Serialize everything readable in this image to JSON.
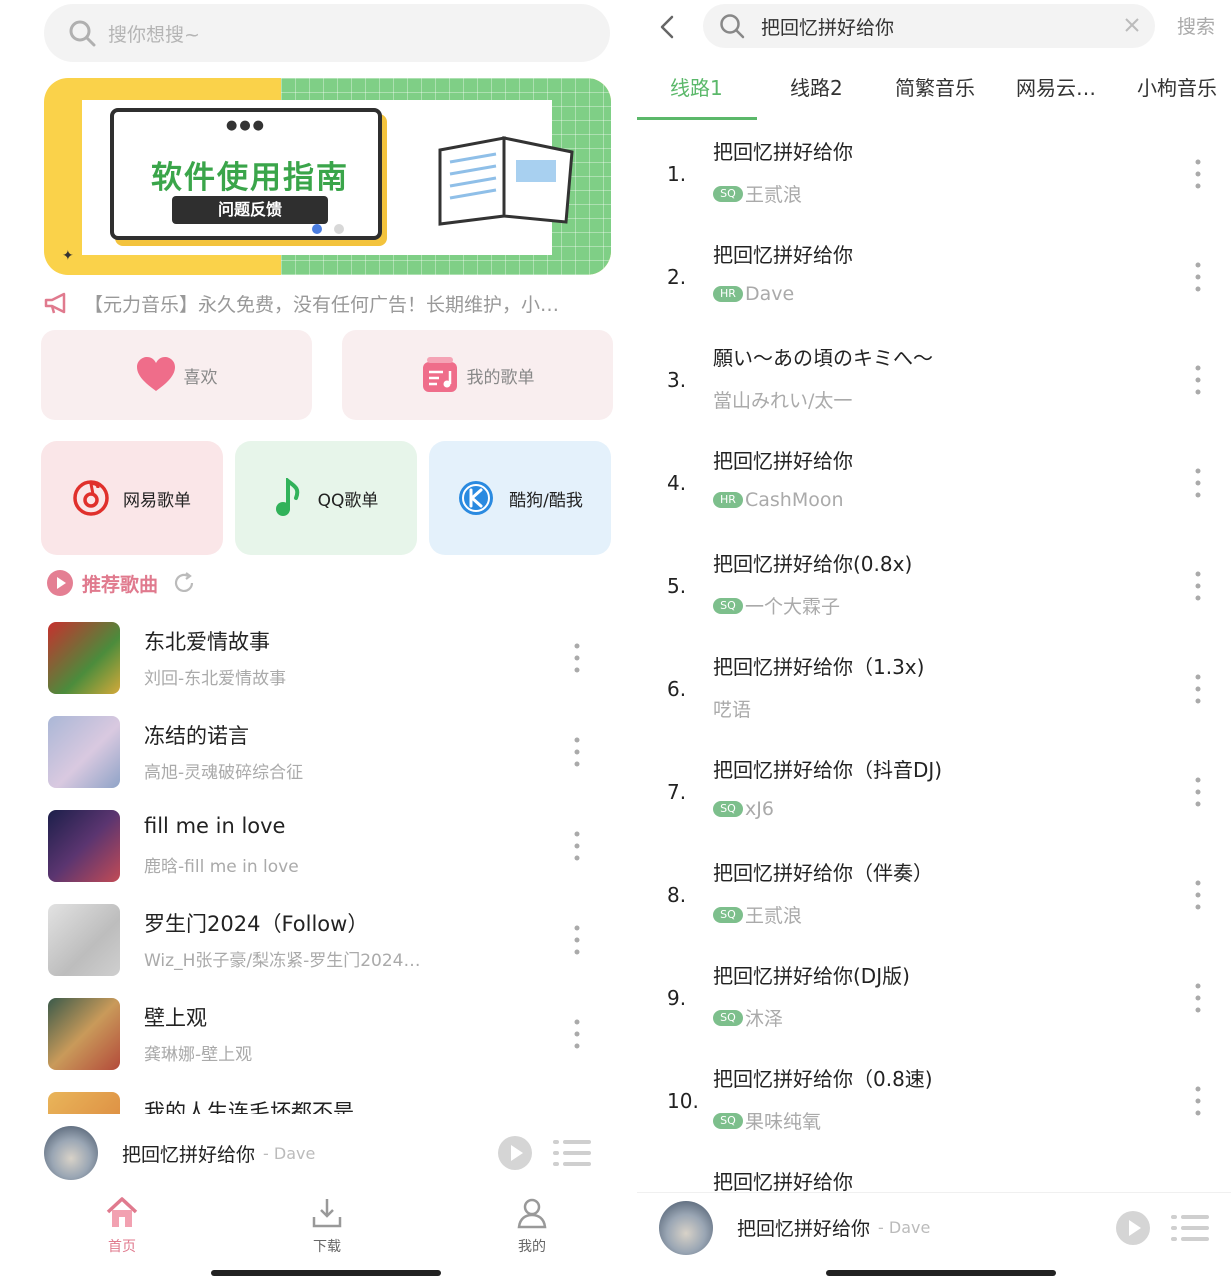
{
  "left": {
    "search": {
      "placeholder": "搜你想搜~"
    },
    "banner": {
      "dots": "●●●",
      "title": "软件使用指南",
      "tag": "问题反馈"
    },
    "notice": "【元力音乐】永久免费，没有任何广告！长期维护，小…",
    "quick": [
      {
        "label": "喜欢",
        "icon": "heart-icon"
      },
      {
        "label": "我的歌单",
        "icon": "playlist-icon"
      }
    ],
    "platforms": [
      {
        "label": "网易歌单",
        "icon": "netease-icon",
        "bg": "#fae6e8"
      },
      {
        "label": "QQ歌单",
        "icon": "qq-music-icon",
        "bg": "#e7f5ea"
      },
      {
        "label": "酷狗/酷我",
        "icon": "kugou-icon",
        "bg": "#e4f1fb"
      }
    ],
    "recommend_title": "推荐歌曲",
    "songs": [
      {
        "title": "东北爱情故事",
        "sub": "刘回-东北爱情故事"
      },
      {
        "title": "冻结的诺言",
        "sub": "高旭-灵魂破碎综合征"
      },
      {
        "title": "fill me in love",
        "sub": "鹿晗-fill me in love"
      },
      {
        "title": "罗生门2024（Follow）",
        "sub": "Wiz_H张子豪/梨冻紧-罗生门2024…"
      },
      {
        "title": "壁上观",
        "sub": "龚琳娜-壁上观"
      },
      {
        "title": "我的人生连毛坏都不是",
        "sub": ""
      }
    ],
    "player": {
      "title": "把回忆拼好给你",
      "artist": "- Dave"
    },
    "nav": [
      {
        "label": "首页",
        "icon": "home-icon"
      },
      {
        "label": "下载",
        "icon": "download-icon"
      },
      {
        "label": "我的",
        "icon": "user-icon"
      }
    ]
  },
  "right": {
    "query": "把回忆拼好给你",
    "search_button": "搜索",
    "tabs": [
      "线路1",
      "线路2",
      "简繁音乐",
      "网易云…",
      "小枸音乐"
    ],
    "results": [
      {
        "num": "1.",
        "title": "把回忆拼好给你",
        "quality": "SQ",
        "artist": "王贰浪"
      },
      {
        "num": "2.",
        "title": "把回忆拼好给你",
        "quality": "HR",
        "artist": "Dave"
      },
      {
        "num": "3.",
        "title": "願い～あの頃のキミへ～",
        "quality": "",
        "artist": "當山みれい/太一"
      },
      {
        "num": "4.",
        "title": "把回忆拼好给你",
        "quality": "HR",
        "artist": "CashMoon"
      },
      {
        "num": "5.",
        "title": "把回忆拼好给你(0.8x)",
        "quality": "SQ",
        "artist": "一个大霖子"
      },
      {
        "num": "6.",
        "title": "把回忆拼好给你（1.3x)",
        "quality": "",
        "artist": "呓语"
      },
      {
        "num": "7.",
        "title": "把回忆拼好给你（抖音DJ)",
        "quality": "SQ",
        "artist": "xJ6"
      },
      {
        "num": "8.",
        "title": "把回忆拼好给你（伴奏）",
        "quality": "SQ",
        "artist": "王贰浪"
      },
      {
        "num": "9.",
        "title": "把回忆拼好给你(DJ版)",
        "quality": "SQ",
        "artist": "沐泽"
      },
      {
        "num": "10.",
        "title": "把回忆拼好给你（0.8速)",
        "quality": "SQ",
        "artist": "果味纯氧"
      },
      {
        "num": "",
        "title": "把回忆拼好给你",
        "quality": "",
        "artist": ""
      }
    ],
    "player": {
      "title": "把回忆拼好给你",
      "artist": "- Dave"
    }
  },
  "colors": {
    "accent_green": "#5bb86a",
    "accent_pink": "#e07a8e",
    "home_active": "#e07a8e"
  }
}
